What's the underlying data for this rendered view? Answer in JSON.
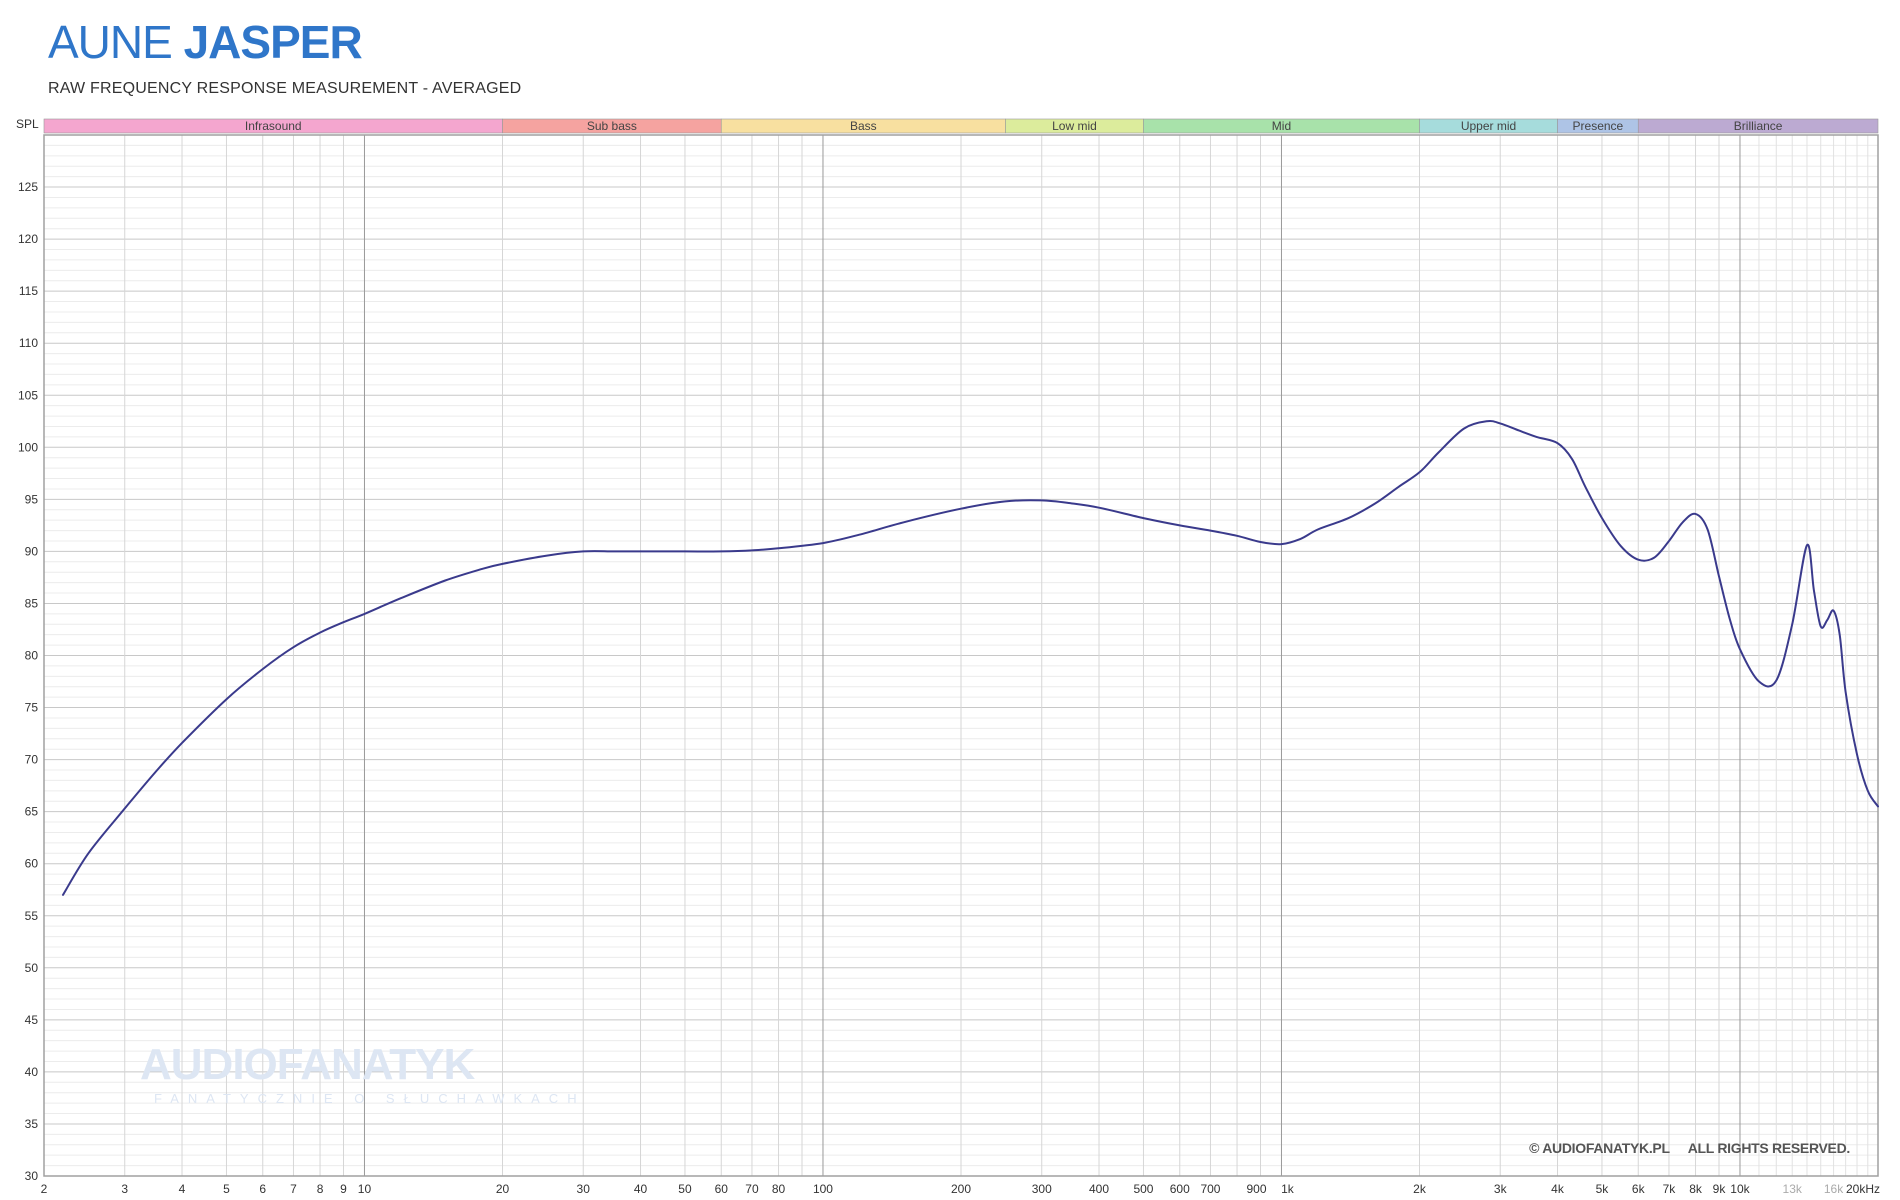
{
  "header": {
    "brand": "AUNE",
    "model": "JASPER",
    "subtitle": "RAW FREQUENCY RESPONSE MEASUREMENT  -  AVERAGED"
  },
  "watermark": {
    "main": "AUDIOFANATYK",
    "sub": "FANATYCZNIE O SŁUCHAWKACH"
  },
  "copyright": {
    "site": "© AUDIOFANATYK.PL",
    "rights": "ALL RIGHTS RESERVED."
  },
  "chart_data": {
    "type": "line",
    "title": "RAW FREQUENCY RESPONSE MEASUREMENT  -  AVERAGED",
    "ylabel": "SPL",
    "xscale": "log",
    "xlim": [
      2,
      20000
    ],
    "ylim": [
      30,
      130
    ],
    "grid": true,
    "line_color": "#3a3a8c",
    "y_ticks": [
      30,
      35,
      40,
      45,
      50,
      55,
      60,
      65,
      70,
      75,
      80,
      85,
      90,
      95,
      100,
      105,
      110,
      115,
      120,
      125
    ],
    "y_tick_labels": [
      "30",
      "35",
      "40",
      "45",
      "50",
      "55",
      "60",
      "65",
      "70",
      "75",
      "80",
      "85",
      "90",
      "95",
      "100",
      "105",
      "110",
      "115",
      "120",
      "125"
    ],
    "x_ticks": [
      {
        "value": 2,
        "label": "2"
      },
      {
        "value": 3,
        "label": "3"
      },
      {
        "value": 4,
        "label": "4"
      },
      {
        "value": 5,
        "label": "5"
      },
      {
        "value": 6,
        "label": "6"
      },
      {
        "value": 7,
        "label": "7"
      },
      {
        "value": 8,
        "label": "8"
      },
      {
        "value": 9,
        "label": "9"
      },
      {
        "value": 10,
        "label": "10"
      },
      {
        "value": 20,
        "label": "20"
      },
      {
        "value": 30,
        "label": "30"
      },
      {
        "value": 40,
        "label": "40"
      },
      {
        "value": 50,
        "label": "50"
      },
      {
        "value": 60,
        "label": "60"
      },
      {
        "value": 70,
        "label": "70"
      },
      {
        "value": 80,
        "label": "80"
      },
      {
        "value": 100,
        "label": "100"
      },
      {
        "value": 200,
        "label": "200"
      },
      {
        "value": 300,
        "label": "300"
      },
      {
        "value": 400,
        "label": "400"
      },
      {
        "value": 500,
        "label": "500"
      },
      {
        "value": 600,
        "label": "600"
      },
      {
        "value": 700,
        "label": "700"
      },
      {
        "value": 900,
        "label": "900"
      },
      {
        "value": 1000,
        "label": "1k"
      },
      {
        "value": 2000,
        "label": "2k"
      },
      {
        "value": 3000,
        "label": "3k"
      },
      {
        "value": 4000,
        "label": "4k"
      },
      {
        "value": 5000,
        "label": "5k"
      },
      {
        "value": 6000,
        "label": "6k"
      },
      {
        "value": 7000,
        "label": "7k"
      },
      {
        "value": 8000,
        "label": "8k"
      },
      {
        "value": 9000,
        "label": "9k"
      },
      {
        "value": 10000,
        "label": "10k"
      },
      {
        "value": 13000,
        "label": "13k",
        "muted": true
      },
      {
        "value": 16000,
        "label": "16k",
        "muted": true
      },
      {
        "value": 20000,
        "label": "20kHz"
      }
    ],
    "bands": [
      {
        "name": "Infrasound",
        "from": 2,
        "to": 20,
        "color": "#f4a6cf"
      },
      {
        "name": "Sub bass",
        "from": 20,
        "to": 60,
        "color": "#f5a3a0"
      },
      {
        "name": "Bass",
        "from": 60,
        "to": 250,
        "color": "#f8e0a0"
      },
      {
        "name": "Low mid",
        "from": 250,
        "to": 500,
        "color": "#dcec9c"
      },
      {
        "name": "Mid",
        "from": 500,
        "to": 2000,
        "color": "#a8e2aa"
      },
      {
        "name": "Upper mid",
        "from": 2000,
        "to": 4000,
        "color": "#a6dcdc"
      },
      {
        "name": "Presence",
        "from": 4000,
        "to": 6000,
        "color": "#aec4e6"
      },
      {
        "name": "Brilliance",
        "from": 6000,
        "to": 20000,
        "color": "#bcaad2"
      }
    ],
    "series": [
      {
        "name": "",
        "x": [
          2.2,
          2.5,
          3,
          3.5,
          4,
          5,
          6,
          7,
          8,
          9,
          10,
          12,
          15,
          18,
          20,
          25,
          30,
          35,
          40,
          50,
          60,
          70,
          80,
          100,
          120,
          150,
          200,
          250,
          300,
          350,
          400,
          500,
          600,
          700,
          800,
          900,
          1000,
          1100,
          1200,
          1400,
          1600,
          1800,
          2000,
          2200,
          2500,
          2800,
          3000,
          3300,
          3600,
          4000,
          4300,
          4600,
          5000,
          5500,
          6000,
          6500,
          7000,
          7500,
          8000,
          8500,
          9000,
          9500,
          10000,
          11000,
          12000,
          13000,
          14000,
          14500,
          15000,
          15500,
          16000,
          16500,
          17000,
          18000,
          19000,
          20000
        ],
        "y": [
          57,
          61,
          65.3,
          68.8,
          71.6,
          75.8,
          78.7,
          80.8,
          82.2,
          83.2,
          84,
          85.5,
          87.2,
          88.3,
          88.8,
          89.6,
          90,
          90,
          90,
          90,
          90,
          90.1,
          90.3,
          90.8,
          91.6,
          92.8,
          94.1,
          94.8,
          94.9,
          94.6,
          94.2,
          93.2,
          92.5,
          92,
          91.5,
          90.9,
          90.7,
          91.2,
          92.1,
          93.2,
          94.6,
          96.2,
          97.6,
          99.5,
          101.8,
          102.5,
          102.3,
          101.6,
          101,
          100.4,
          98.9,
          96.2,
          93.2,
          90.5,
          89.2,
          89.4,
          91,
          92.8,
          93.6,
          92.1,
          87.6,
          83.5,
          80.6,
          77.5,
          77.6,
          83,
          90.6,
          86.2,
          82.8,
          83.4,
          84.3,
          82,
          76.5,
          70.5,
          67,
          65.5
        ]
      }
    ]
  }
}
